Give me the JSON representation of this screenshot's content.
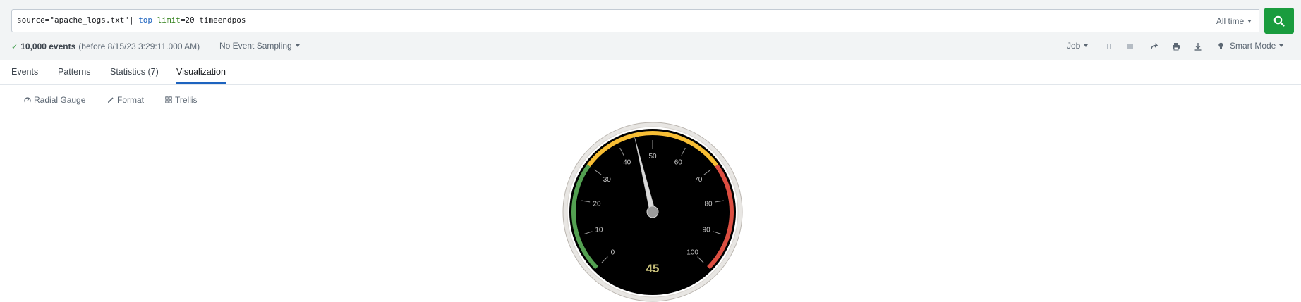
{
  "search": {
    "query_source": "source=\"apache_logs.txt\"| ",
    "query_command": "top",
    "query_arg_name": "limit",
    "query_rest": "=20 timeendpos",
    "time_range": "All time"
  },
  "status": {
    "event_count": "10,000 events",
    "event_range": "(before 8/15/23 3:29:11.000 AM)",
    "sampling": "No Event Sampling",
    "job_label": "Job",
    "mode": "Smart Mode"
  },
  "tabs": [
    {
      "label": "Events"
    },
    {
      "label": "Patterns"
    },
    {
      "label": "Statistics (7)"
    },
    {
      "label": "Visualization",
      "active": true
    }
  ],
  "viz_toolbar": {
    "type_label": "Radial Gauge",
    "format_label": "Format",
    "trellis_label": "Trellis"
  },
  "gauge": {
    "value": 45,
    "value_label": "45",
    "min": 0,
    "max": 100,
    "tick_labels": [
      "0",
      "10",
      "20",
      "30",
      "40",
      "50",
      "60",
      "70",
      "80",
      "90",
      "100"
    ],
    "ranges": [
      {
        "from": 0,
        "to": 30,
        "color": "#53a051"
      },
      {
        "from": 30,
        "to": 70,
        "color": "#f8be34"
      },
      {
        "from": 70,
        "to": 100,
        "color": "#dc4e41"
      }
    ],
    "value_color": "#c8c07a"
  },
  "colors": {
    "accent": "#1d63bf",
    "search_button": "#1a9c3e"
  }
}
